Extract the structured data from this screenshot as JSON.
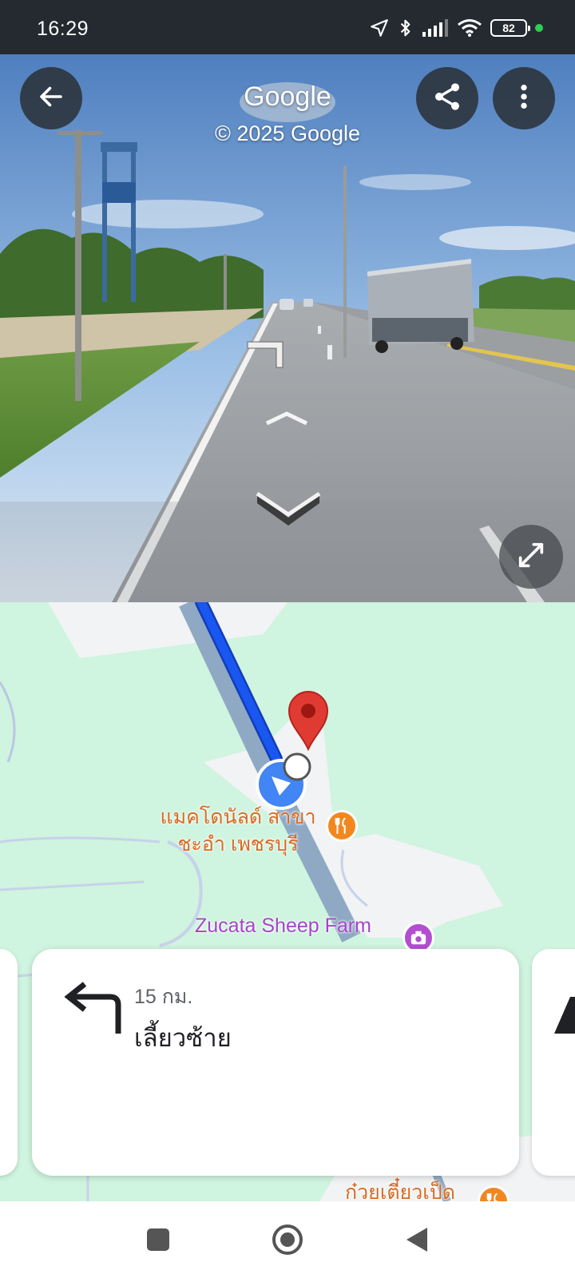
{
  "status_bar": {
    "time": "16:29",
    "battery": "82",
    "icons": [
      "location-arrow-icon",
      "bluetooth-icon",
      "signal-icon",
      "wifi-icon",
      "battery-icon",
      "active-dot-icon"
    ]
  },
  "street_view": {
    "brand": "Google",
    "copyright": "© 2025 Google",
    "buttons": [
      "back-arrow-icon",
      "share-icon",
      "more-vert-icon",
      "expand-icon"
    ]
  },
  "map": {
    "poi_mcdonalds": "แมคโดนัลด์ สาขา ชะอำ เพชรบุรี",
    "poi_farm": "Zucata Sheep Farm",
    "poi_duck_noodle": "ก๋วยเตี๋ยวเป็ด",
    "colors": {
      "land": "#cff4df",
      "route": "#1a56f0",
      "road": "#8fa9c4",
      "pin": "#e03b32"
    }
  },
  "direction_card": {
    "distance": "15 กม.",
    "instruction": "เลี้ยวซ้าย",
    "icon": "turn-left-icon"
  },
  "nav_bar": {
    "buttons": [
      "recents-square-icon",
      "home-circle-icon",
      "back-triangle-icon"
    ]
  }
}
